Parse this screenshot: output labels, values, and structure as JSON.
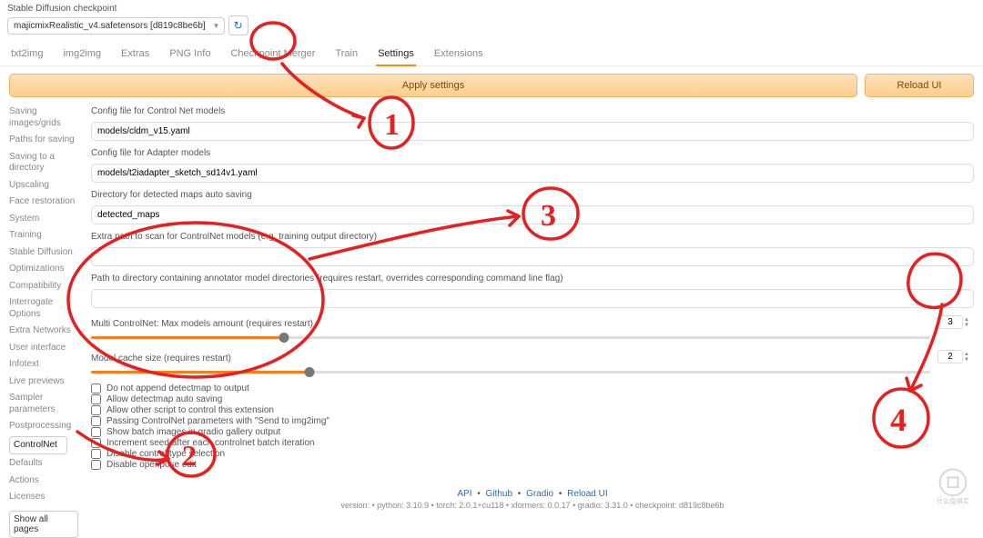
{
  "header": {
    "ckpt_label": "Stable Diffusion checkpoint",
    "ckpt_value": "majicmixRealistic_v4.safetensors [d819c8be6b]"
  },
  "tabs": [
    "txt2img",
    "img2img",
    "Extras",
    "PNG Info",
    "Checkpoint Merger",
    "Train",
    "Settings",
    "Extensions"
  ],
  "active_tab": "Settings",
  "buttons": {
    "apply": "Apply settings",
    "reload": "Reload UI"
  },
  "sidebar": {
    "items": [
      "Saving images/grids",
      "Paths for saving",
      "Saving to a directory",
      "Upscaling",
      "Face restoration",
      "System",
      "Training",
      "Stable Diffusion",
      "Optimizations",
      "Compatibility",
      "Interrogate Options",
      "Extra Networks",
      "User interface",
      "Infotext",
      "Live previews",
      "Sampler parameters",
      "Postprocessing",
      "ControlNet",
      "Defaults",
      "Actions",
      "Licenses"
    ],
    "active": "ControlNet",
    "show_all": "Show all pages"
  },
  "fields": {
    "cfg_cn_label": "Config file for Control Net models",
    "cfg_cn_value": "models/cldm_v15.yaml",
    "cfg_ad_label": "Config file for Adapter models",
    "cfg_ad_value": "models/t2iadapter_sketch_sd14v1.yaml",
    "dir_det_label": "Directory for detected maps auto saving",
    "dir_det_value": "detected_maps",
    "extra_path_label": "Extra path to scan for ControlNet models (e.g. training output directory)",
    "extra_path_value": "",
    "anno_dir_label": "Path to directory containing annotator model directories (requires restart, overrides corresponding command line flag)",
    "anno_dir_value": ""
  },
  "sliders": {
    "multi": {
      "label": "Multi ControlNet: Max models amount (requires restart)",
      "value": 3,
      "pct": 23
    },
    "cache": {
      "label": "Model cache size (requires restart)",
      "value": 2,
      "pct": 26
    }
  },
  "checks": [
    "Do not append detectmap to output",
    "Allow detectmap auto saving",
    "Allow other script to control this extension",
    "Passing ControlNet parameters with \"Send to img2img\"",
    "Show batch images in gradio gallery output",
    "Increment seed after each controlnet batch iteration",
    "Disable control type selection",
    "Disable openpose edit"
  ],
  "footer": {
    "links": [
      "API",
      "Github",
      "Gradio",
      "Reload UI"
    ],
    "version_prefix": "version:",
    "python": "python: 3.10.9",
    "torch": "torch: 2.0.1+cu118",
    "xformers": "xformers: 0.0.17",
    "gradio": "gradio: 3.31.0",
    "checkpoint": "checkpoint: d819c8be6b"
  }
}
